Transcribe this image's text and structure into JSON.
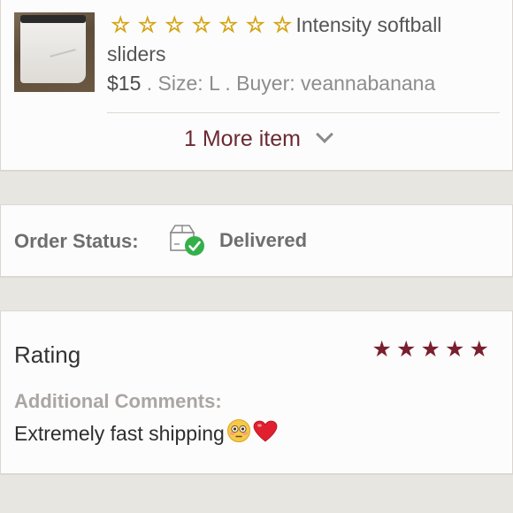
{
  "item": {
    "star_glyph": "☆",
    "star_count": 7,
    "title": "Intensity softball sliders",
    "price": "$15",
    "size_text": " . Size: L . Buyer: veannabanana",
    "more_items": "1 More item"
  },
  "order": {
    "status_label": "Order Status:",
    "status_value": "Delivered"
  },
  "rating": {
    "label": "Rating",
    "value": 5,
    "max": 5,
    "comments_label": "Additional Comments:",
    "comments_text": "Extremely fast shipping"
  },
  "colors": {
    "accent": "#6b2a33",
    "rating_star": "#7a1f2e",
    "status_check": "#34b04a"
  },
  "icons": {
    "box": "delivered-box-icon",
    "chevron": "chevron-down-icon",
    "emoji_flushed": "flushed-face-emoji",
    "emoji_heart": "red-heart-emoji"
  }
}
